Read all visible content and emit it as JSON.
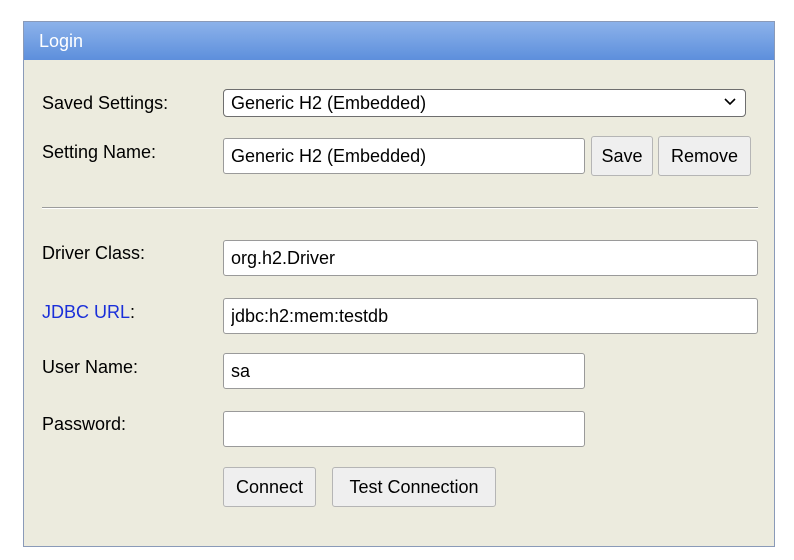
{
  "window": {
    "title": "Login"
  },
  "saved_settings": {
    "label": "Saved Settings:",
    "selected": "Generic H2 (Embedded)",
    "chevron_icon": "chevron-down-icon"
  },
  "setting_name": {
    "label": "Setting Name:",
    "value": "Generic H2 (Embedded)",
    "save_label": "Save",
    "remove_label": "Remove"
  },
  "driver_class": {
    "label": "Driver Class:",
    "value": "org.h2.Driver"
  },
  "jdbc_url": {
    "link_text": "JDBC URL",
    "colon": ":",
    "value": "jdbc:h2:mem:testdb"
  },
  "user_name": {
    "label": "User Name:",
    "value": "sa"
  },
  "password": {
    "label": "Password:",
    "value": ""
  },
  "actions": {
    "connect_label": "Connect",
    "test_label": "Test Connection"
  },
  "colors": {
    "title_bar": "#6f9fe2",
    "panel_background": "#ecebde",
    "link": "#1a2fd9"
  }
}
